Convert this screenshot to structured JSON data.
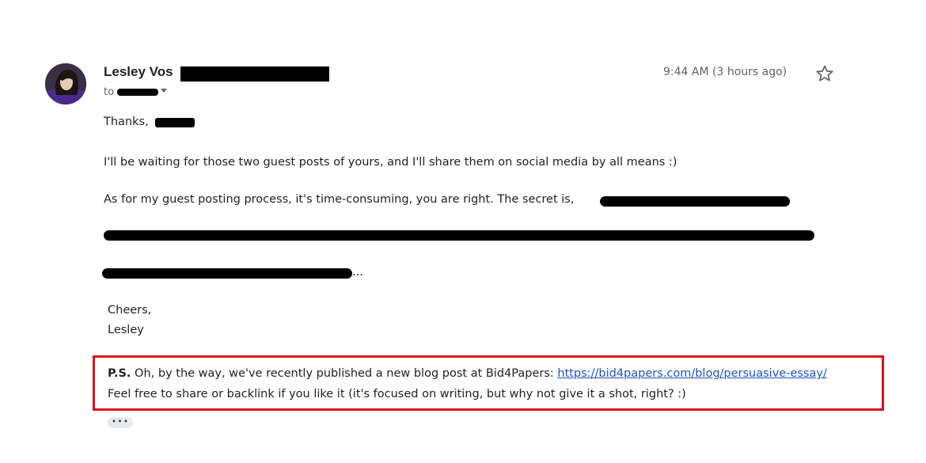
{
  "header": {
    "sender_name": "Lesley Vos",
    "to_prefix": "to",
    "timestamp": "9:44 AM (3 hours ago)"
  },
  "icons": {
    "star": "star-outline-icon",
    "recipient_details": "chevron-down-icon",
    "expand": "ellipsis-icon"
  },
  "message": {
    "greeting": "Thanks,",
    "para1": "I'll be waiting for those two guest posts of yours, and I'll share them on social media by all means :)",
    "para2_visible": "As for my guest posting process, it's time-consuming, you are right. The secret is,",
    "para4_tail": "...",
    "signoff": "Cheers,",
    "signature": "Lesley"
  },
  "postscript": {
    "label": "P.S.",
    "text": " Oh, by the way, we've recently published a new blog post at Bid4Papers: ",
    "link": "https://bid4papers.com/blog/persuasive-essay/",
    "line2": "Feel free to share or backlink if you like it (it's focused on writing, but why not give it a shot, right? :)"
  },
  "expand_label": "•••",
  "colors": {
    "highlight_border": "#e0121d",
    "link": "#1a55c7",
    "redaction": "#000000"
  }
}
